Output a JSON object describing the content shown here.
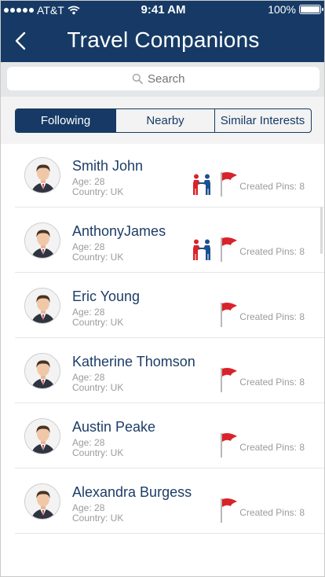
{
  "status": {
    "carrier": "AT&T",
    "time": "9:41 AM",
    "battery": "100%"
  },
  "header": {
    "title": "Travel Companions"
  },
  "search": {
    "placeholder": "Search"
  },
  "tabs": [
    {
      "label": "Following",
      "active": true
    },
    {
      "label": "Nearby",
      "active": false
    },
    {
      "label": "Similar Interests",
      "active": false
    }
  ],
  "companions": [
    {
      "name": "Smith John",
      "age": "Age: 28",
      "country": "Country: UK",
      "pins": "Created Pins: 8",
      "icon": "handshake-icon"
    },
    {
      "name": "AnthonyJames",
      "age": "Age: 28",
      "country": "Country: UK",
      "pins": "Created Pins: 8",
      "icon": "handshake-icon"
    },
    {
      "name": "Eric Young",
      "age": "Age: 28",
      "country": "Country: UK",
      "pins": "Created Pins: 8"
    },
    {
      "name": "Katherine Thomson",
      "age": "Age: 28",
      "country": "Country: UK",
      "pins": "Created Pins: 8"
    },
    {
      "name": "Austin Peake",
      "age": "Age: 28",
      "country": "Country: UK",
      "pins": "Created Pins: 8"
    },
    {
      "name": "Alexandra Burgess",
      "age": "Age: 28",
      "country": "Country: UK",
      "pins": "Created Pins: 8"
    }
  ],
  "colors": {
    "brand": "#163a65",
    "flag": "#d8232a",
    "handshake_red": "#d8232a",
    "handshake_blue": "#1d4f91"
  }
}
